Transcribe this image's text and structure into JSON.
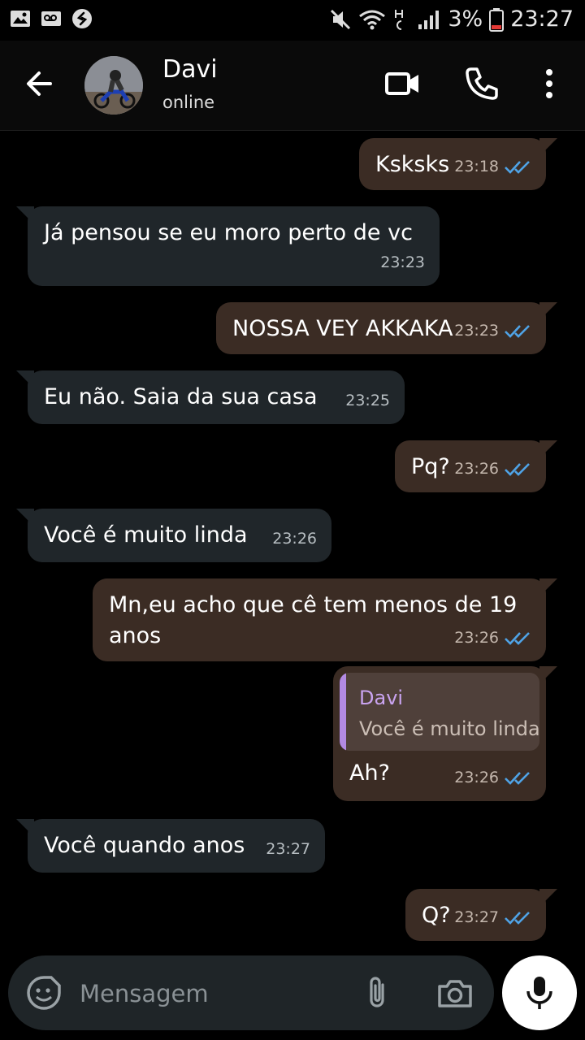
{
  "status_bar": {
    "battery": "3%",
    "time": "23:27",
    "icons": [
      "gallery-icon",
      "voicemail-icon",
      "shazam-icon",
      "mute-icon",
      "wifi-icon",
      "signal-icon",
      "battery-icon"
    ]
  },
  "header": {
    "contact_name": "Davi",
    "status": "online",
    "icons": [
      "back-arrow-icon",
      "video-call-icon",
      "phone-icon",
      "more-options-icon"
    ]
  },
  "messages": [
    {
      "dir": "out",
      "text": "Ksksks",
      "time": "23:18",
      "read": true
    },
    {
      "dir": "in",
      "text": "Já pensou se eu moro perto de vc",
      "time": "23:23"
    },
    {
      "dir": "out",
      "text": "NOSSA VEY AKKAKA",
      "time": "23:23",
      "read": true
    },
    {
      "dir": "in",
      "text": "Eu não. Saia da sua casa",
      "time": "23:25"
    },
    {
      "dir": "out",
      "text": "Pq?",
      "time": "23:26",
      "read": true
    },
    {
      "dir": "in",
      "text": "Você é muito linda",
      "time": "23:26"
    },
    {
      "dir": "out",
      "text_line1": "Mn,eu acho que cê tem menos de 19",
      "text_line2": "anos",
      "time": "23:26",
      "read": true
    },
    {
      "dir": "out",
      "quoted_name": "Davi",
      "quoted_text": "Você é muito linda",
      "text": "Ah?",
      "time": "23:26",
      "read": true
    },
    {
      "dir": "in",
      "text": "Você quando anos",
      "time": "23:27"
    },
    {
      "dir": "out",
      "text": "Q?",
      "time": "23:27",
      "read": true
    }
  ],
  "composer": {
    "placeholder": "Mensagem",
    "icons": [
      "sticker-icon",
      "attach-icon",
      "camera-icon",
      "mic-icon"
    ]
  },
  "colors": {
    "outgoing_bubble": "#3b2c24",
    "incoming_bubble": "#20262a",
    "read_tick": "#4fa3e6",
    "quote_accent": "#b28ae3",
    "background": "#000000"
  }
}
